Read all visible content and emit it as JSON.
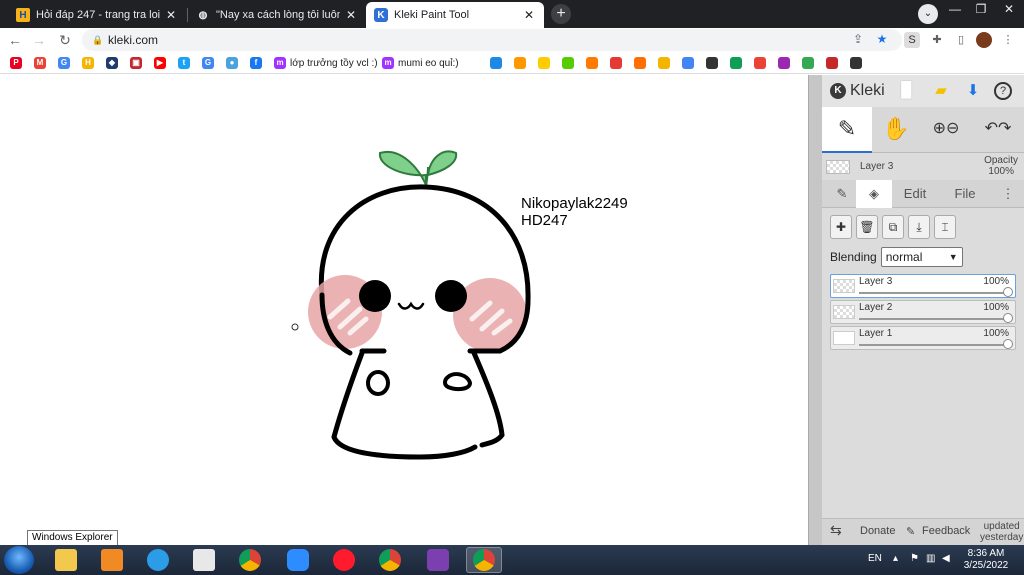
{
  "browser": {
    "tabs": [
      {
        "title": "Hỏi đáp 247 - trang tra loi",
        "favicon": "H"
      },
      {
        "title": "\"Nay xa cách lòng tôi luôn tưởng",
        "favicon": "globe"
      },
      {
        "title": "Kleki Paint Tool",
        "favicon": "K"
      }
    ],
    "close_glyph": "✕",
    "new_tab_glyph": "+",
    "url": "kleki.com"
  },
  "bookmarks": [
    {
      "label": "",
      "color": "#e60023",
      "glyph": "P"
    },
    {
      "label": "",
      "color": "#ea4335",
      "glyph": "M"
    },
    {
      "label": "",
      "color": "#4285f4",
      "glyph": "G"
    },
    {
      "label": "",
      "color": "#f4b400",
      "glyph": "H"
    },
    {
      "label": "",
      "color": "#1f3c6e",
      "glyph": "◆"
    },
    {
      "label": "",
      "color": "#c1272d",
      "glyph": "▣"
    },
    {
      "label": "",
      "color": "#ff0000",
      "glyph": "▶"
    },
    {
      "label": "",
      "color": "#1da1f2",
      "glyph": "t"
    },
    {
      "label": "",
      "color": "#4285f4",
      "glyph": "G"
    },
    {
      "label": "",
      "color": "#4aa3df",
      "glyph": "●"
    },
    {
      "label": "",
      "color": "#1877f2",
      "glyph": "f"
    },
    {
      "label": "lớp trưởng tồy vcl :)",
      "color": "#a033ff",
      "glyph": "m"
    },
    {
      "label": "mumi eo quỉ:)",
      "color": "#a033ff",
      "glyph": "m"
    }
  ],
  "drawing": {
    "signature_line1": "Nikopaylak2249",
    "signature_line2": "HD247"
  },
  "tooltip": "Windows Explorer",
  "kleki": {
    "brand": "Kleki",
    "layer_name": "Layer 3",
    "opacity_label": "Opacity",
    "opacity_value": "100%",
    "tabs": [
      "Edit",
      "File"
    ],
    "blending_label": "Blending",
    "blending_value": "normal",
    "layers": [
      {
        "name": "Layer 3",
        "opacity": "100%"
      },
      {
        "name": "Layer 2",
        "opacity": "100%"
      },
      {
        "name": "Layer 1",
        "opacity": "100%"
      }
    ],
    "footer": {
      "donate": "Donate",
      "feedback": "Feedback",
      "updated_line1": "updated",
      "updated_line2": "yesterday"
    }
  },
  "taskbar": {
    "language": "EN",
    "time": "8:36 AM",
    "date": "3/25/2022"
  }
}
